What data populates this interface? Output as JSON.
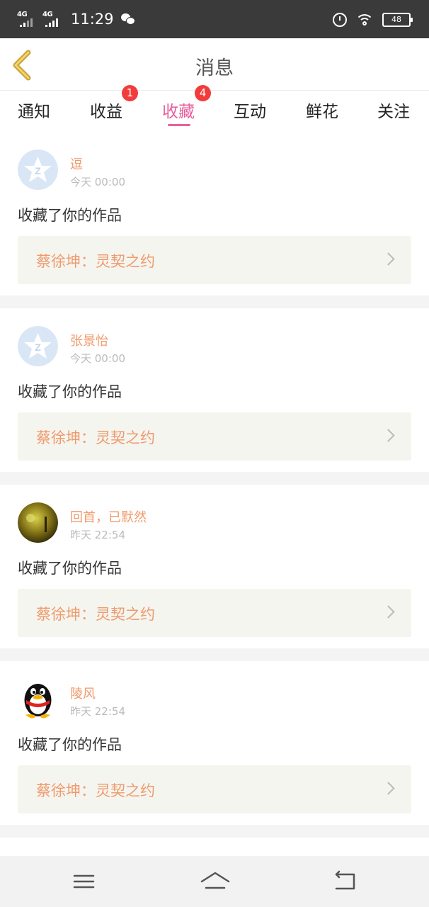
{
  "status_bar": {
    "network_1": "4G",
    "network_2": "4G",
    "time": "11:29",
    "battery": "48",
    "icons": [
      "signal-icon",
      "wechat-icon",
      "alarm-icon",
      "wifi-icon",
      "battery-icon"
    ]
  },
  "header": {
    "title": "消息",
    "back_icon": "chevron-left-icon"
  },
  "tabs": [
    {
      "label": "通知"
    },
    {
      "label": "收益",
      "badge": "1"
    },
    {
      "label": "收藏",
      "badge": "4",
      "active": true
    },
    {
      "label": "互动"
    },
    {
      "label": "鲜花"
    },
    {
      "label": "关注"
    }
  ],
  "colors": {
    "accent": "#e8609e",
    "name": "#ef9a6c",
    "badge": "#f23c3c",
    "status_bar": "#3a3a3a"
  },
  "messages": [
    {
      "user": "逗",
      "time": "今天 00:00",
      "action": "收藏了你的作品",
      "work": "蔡徐坤：灵契之约",
      "avatar": "qq-default-avatar"
    },
    {
      "user": "张景怡",
      "time": "今天 00:00",
      "action": "收藏了你的作品",
      "work": "蔡徐坤：灵契之约",
      "avatar": "qq-default-avatar"
    },
    {
      "user": "回首，已默然",
      "time": "昨天 22:54",
      "action": "收藏了你的作品",
      "work": "蔡徐坤：灵契之约",
      "avatar": "photo-avatar"
    },
    {
      "user": "陵风",
      "time": "昨天 22:54",
      "action": "收藏了你的作品",
      "work": "蔡徐坤：灵契之约",
      "avatar": "penguin-avatar"
    }
  ],
  "nav_bar": {
    "icons": [
      "menu-icon",
      "home-icon",
      "back-icon"
    ]
  }
}
